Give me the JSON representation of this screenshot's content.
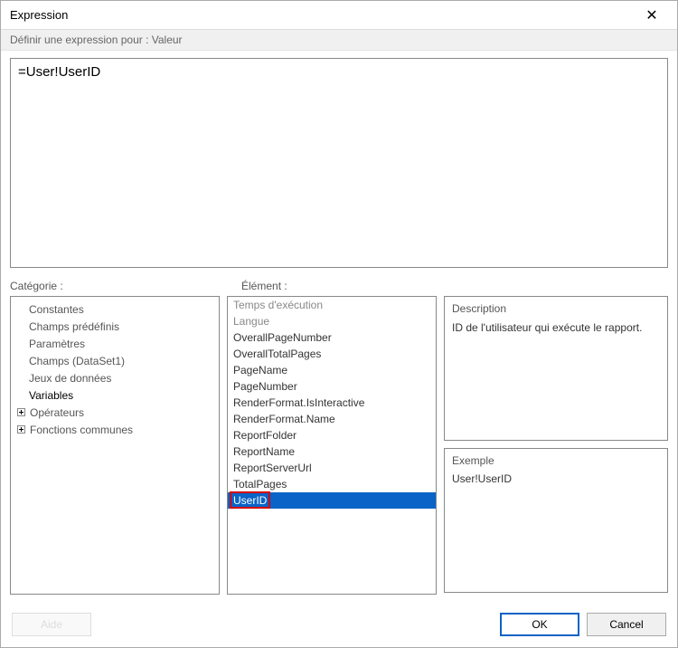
{
  "window": {
    "title": "Expression",
    "close": "✕"
  },
  "subheader": "Définir une expression pour : Valeur",
  "editor_value": "=User!UserID",
  "labels": {
    "category": "Catégorie :",
    "element": "Élément :"
  },
  "category_tree": {
    "items": [
      {
        "label": "Constantes",
        "level": 1,
        "expandable": false
      },
      {
        "label": "Champs prédéfinis",
        "level": 1,
        "expandable": false
      },
      {
        "label": "Paramètres",
        "level": 1,
        "expandable": false
      },
      {
        "label": "Champs (DataSet1)",
        "level": 1,
        "expandable": false
      },
      {
        "label": "Jeux de données",
        "level": 1,
        "expandable": false
      },
      {
        "label": "Variables",
        "level": 1,
        "expandable": false,
        "bold": true
      },
      {
        "label": "Opérateurs",
        "level": 0,
        "expandable": true
      },
      {
        "label": "Fonctions communes",
        "level": 0,
        "expandable": true
      }
    ]
  },
  "elements": {
    "items": [
      {
        "label": "Temps d'exécution",
        "dim": true
      },
      {
        "label": "Langue",
        "dim": true
      },
      {
        "label": "OverallPageNumber"
      },
      {
        "label": "OverallTotalPages"
      },
      {
        "label": "PageName"
      },
      {
        "label": "PageNumber"
      },
      {
        "label": "RenderFormat.IsInteractive"
      },
      {
        "label": "RenderFormat.Name"
      },
      {
        "label": "ReportFolder"
      },
      {
        "label": "ReportName"
      },
      {
        "label": "ReportServerUrl"
      },
      {
        "label": "TotalPages"
      },
      {
        "label": "UserID",
        "selected": true,
        "highlight_red": true
      }
    ]
  },
  "description": {
    "heading": "Description",
    "text": "ID de l'utilisateur qui exécute le rapport."
  },
  "example": {
    "heading": "Exemple",
    "text": "User!UserID"
  },
  "buttons": {
    "help": "Aide",
    "ok": "OK",
    "cancel": "Cancel"
  }
}
